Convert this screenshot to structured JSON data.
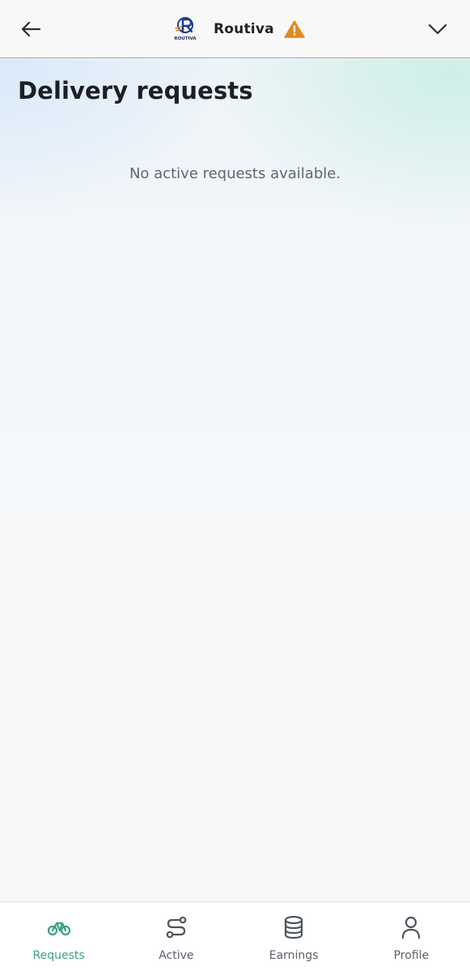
{
  "header": {
    "brand_name": "Routiva",
    "logo_text": "ROUTIVA",
    "icons": {
      "back": "arrow-left-icon",
      "warning": "warning-icon",
      "menu": "chevron-down-icon"
    },
    "warning_color": "#e08a1e"
  },
  "main": {
    "title": "Delivery requests",
    "empty_message": "No active requests available."
  },
  "bottom_nav": {
    "active_color": "#3aa37d",
    "items": [
      {
        "label": "Requests",
        "icon": "bicycle-icon",
        "active": true
      },
      {
        "label": "Active",
        "icon": "route-icon",
        "active": false
      },
      {
        "label": "Earnings",
        "icon": "database-icon",
        "active": false
      },
      {
        "label": "Profile",
        "icon": "user-icon",
        "active": false
      }
    ]
  }
}
